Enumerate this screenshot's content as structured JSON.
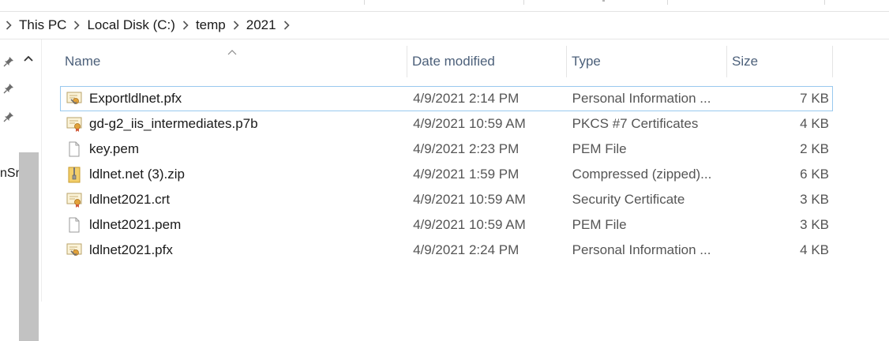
{
  "breadcrumb": {
    "items": [
      "This PC",
      "Local Disk (C:)",
      "temp",
      "2021"
    ]
  },
  "nav": {
    "clipped_text": "nSr"
  },
  "columns": {
    "name": "Name",
    "date": "Date modified",
    "type": "Type",
    "size": "Size"
  },
  "files": [
    {
      "name": "Exportldlnet.pfx",
      "date": "4/9/2021 2:14 PM",
      "type": "Personal Information ...",
      "size": "7 KB",
      "icon": "certificate-key-icon"
    },
    {
      "name": "gd-g2_iis_intermediates.p7b",
      "date": "4/9/2021 10:59 AM",
      "type": "PKCS #7 Certificates",
      "size": "4 KB",
      "icon": "certificate-icon"
    },
    {
      "name": "key.pem",
      "date": "4/9/2021 2:23 PM",
      "type": "PEM File",
      "size": "2 KB",
      "icon": "blank-file-icon"
    },
    {
      "name": "ldlnet.net (3).zip",
      "date": "4/9/2021 1:59 PM",
      "type": "Compressed (zipped)...",
      "size": "6 KB",
      "icon": "zip-folder-icon"
    },
    {
      "name": "ldlnet2021.crt",
      "date": "4/9/2021 10:59 AM",
      "type": "Security Certificate",
      "size": "3 KB",
      "icon": "certificate-icon"
    },
    {
      "name": "ldlnet2021.pem",
      "date": "4/9/2021 10:59 AM",
      "type": "PEM File",
      "size": "3 KB",
      "icon": "blank-file-icon"
    },
    {
      "name": "ldlnet2021.pfx",
      "date": "4/9/2021 2:24 PM",
      "type": "Personal Information ...",
      "size": "4 KB",
      "icon": "certificate-key-icon"
    }
  ]
}
